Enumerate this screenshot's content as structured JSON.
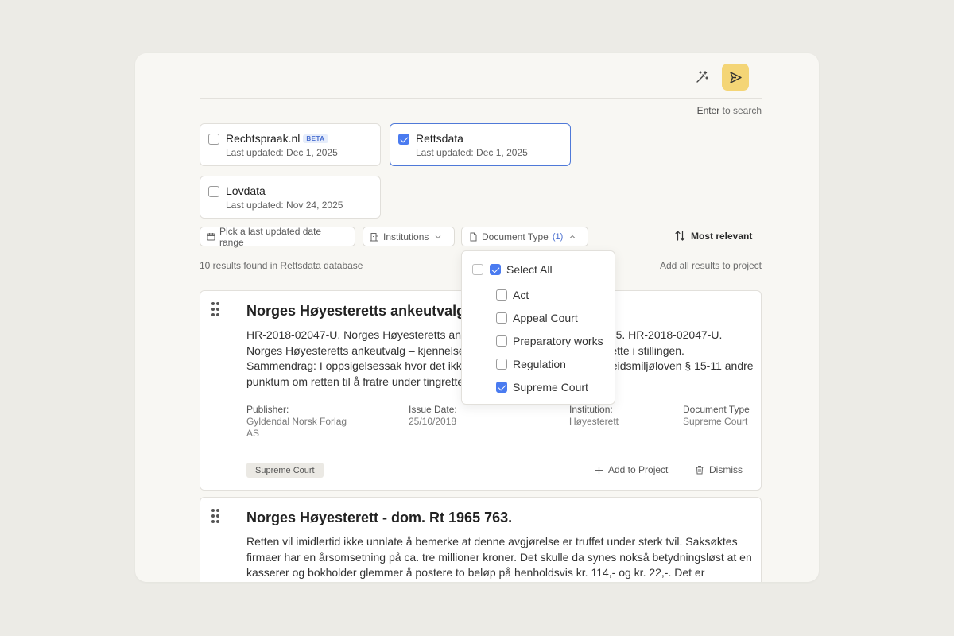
{
  "header": {
    "magic_icon": "magic-wand-icon",
    "send_icon": "send-icon",
    "send_color": "#f4d576",
    "enter_key": "Enter",
    "enter_hint_suffix": " to search"
  },
  "sources": [
    {
      "name": "Rechtspraak.nl",
      "badge": "BETA",
      "updated": "Last updated: Dec 1, 2025",
      "checked": false
    },
    {
      "name": "Rettsdata",
      "badge": "",
      "updated": "Last updated: Dec 1, 2025",
      "checked": true
    },
    {
      "name": "Lovdata",
      "badge": "",
      "updated": "Last updated: Nov 24, 2025",
      "checked": false
    }
  ],
  "filters": {
    "date_range": "Pick a last updated date range",
    "institutions": "Institutions",
    "document_type": "Document Type",
    "document_type_count": "(1)",
    "sort": "Most relevant"
  },
  "results_summary": "10 results found in Rettsdata database",
  "add_all": "Add all results to project",
  "document_type_dropdown": {
    "select_all": "Select All",
    "options": [
      {
        "label": "Act",
        "checked": false
      },
      {
        "label": "Appeal Court",
        "checked": false
      },
      {
        "label": "Preparatory works",
        "checked": false
      },
      {
        "label": "Regulation",
        "checked": false
      },
      {
        "label": "Supreme Court",
        "checked": true
      }
    ]
  },
  "results": [
    {
      "title": "Norges Høyesteretts ankeutvalg",
      "body": "HR-2018-02047-U. Norges Høyesteretts ankeutvalg – kjennelse 2018-10-25. HR-2018-02047-U. Norges Høyesteretts ankeutvalg – kjennelse. Oppsigelse. Retten til å fortsette i stillingen. Sammendrag: I oppsigelsessak hvor det ikke er truffet avgjørelse etter arbeidsmiljøloven § 15-11 andre punktum om retten til å fratre under tingretten...",
      "publisher_label": "Publisher:",
      "publisher": "Gyldendal Norsk Forlag AS",
      "issue_label": "Issue Date:",
      "issue": "25/10/2018",
      "institution_label": "Institution:",
      "institution": "Høyesterett",
      "doctype_label": "Document Type",
      "doctype": "Supreme Court",
      "tag": "Supreme Court",
      "add_label": "Add to Project",
      "dismiss_label": "Dismiss"
    },
    {
      "title": "Norges Høyesterett - dom. Rt 1965 763.",
      "body": "Retten vil imidlertid ikke unnlate å bemerke at denne avgjørelse er truffet under sterk tvil. Saksøktes firmaer har en årsomsetning på ca. tre millioner kroner. Det skulle da synes nokså betydningsløst at en kasserer og bokholder glemmer å postere to beløp på henholdsvis kr. 114,- og kr. 22,-. Det er"
    }
  ]
}
